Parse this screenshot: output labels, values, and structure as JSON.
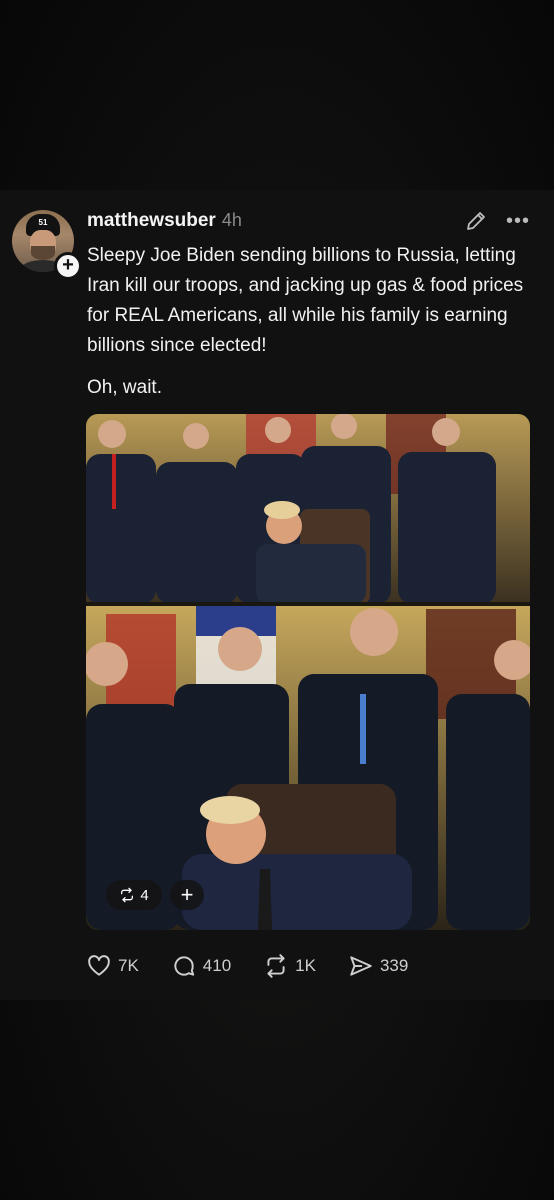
{
  "post": {
    "username": "matthewsuber",
    "time": "4h",
    "avatar_cap_text": "51",
    "text_lines": [
      "Sleepy Joe Biden sending billions to Russia, letting Iran kill our troops, and jacking up gas & food prices for REAL Americans, all while his family is earning billions since elected!",
      "Oh, wait."
    ],
    "media": {
      "repost_count": "4",
      "add_label": "+"
    },
    "actions": {
      "likes": "7K",
      "replies": "410",
      "reposts": "1K",
      "shares": "339"
    }
  },
  "icons": [
    "follow-plus-icon",
    "edit-pencil-icon",
    "more-dots-icon",
    "heart-icon",
    "comment-icon",
    "repost-icon",
    "share-icon"
  ]
}
